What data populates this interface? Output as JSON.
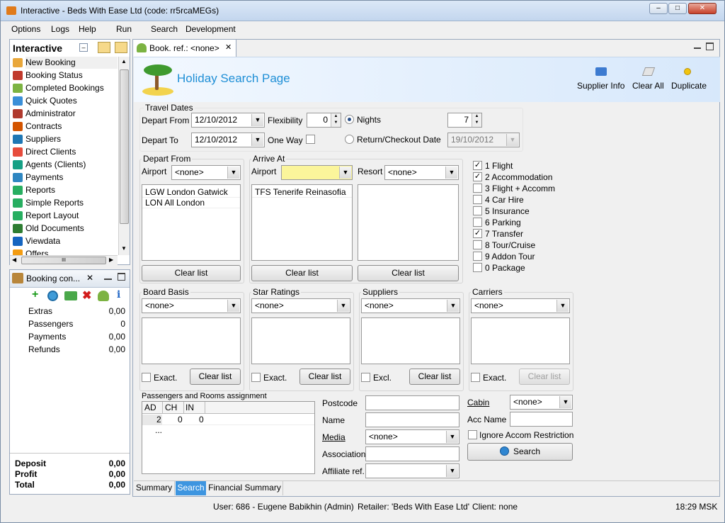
{
  "window": {
    "title": "Interactive - Beds With Ease Ltd (code: rr5rcaMEGs)"
  },
  "menu": [
    "Options",
    "Logs",
    "Help",
    "Run",
    "Search",
    "Development"
  ],
  "nav": {
    "title": "Interactive",
    "items": [
      "New Booking",
      "Booking Status",
      "Completed Bookings",
      "Quick Quotes",
      "Administrator",
      "Contracts",
      "Suppliers",
      "Direct Clients",
      "Agents (Clients)",
      "Payments",
      "Reports",
      "Simple Reports",
      "Report Layout",
      "Old Documents",
      "Viewdata",
      "Offers"
    ],
    "scroll_marker": "III"
  },
  "booking_panel": {
    "title": "Booking con...",
    "rows": [
      {
        "label": "Extras",
        "value": "0,00"
      },
      {
        "label": "Passengers",
        "value": "0"
      },
      {
        "label": "Payments",
        "value": "0,00"
      },
      {
        "label": "Refunds",
        "value": "0,00"
      }
    ],
    "totals": [
      {
        "label": "Deposit",
        "value": "0,00"
      },
      {
        "label": "Profit",
        "value": "0,00"
      },
      {
        "label": "Total",
        "value": "0,00"
      }
    ]
  },
  "tab": {
    "label": "Book. ref.: <none>"
  },
  "page": {
    "title": "Holiday Search Page",
    "actions": [
      "Supplier Info",
      "Clear All",
      "Duplicate"
    ]
  },
  "travel": {
    "group": "Travel Dates",
    "depart_from_label": "Depart From",
    "depart_from": "12/10/2012",
    "depart_to_label": "Depart To",
    "depart_to": "12/10/2012",
    "flexibility_label": "Flexibility",
    "flexibility": "0",
    "one_way_label": "One Way",
    "nights_label": "Nights",
    "nights": "7",
    "return_label": "Return/Checkout Date",
    "return_date": "19/10/2012"
  },
  "depart": {
    "group": "Depart From",
    "airport_label": "Airport",
    "airport": "<none>",
    "items": [
      "LGW London Gatwick",
      "LON All London"
    ],
    "clear": "Clear list"
  },
  "arrive": {
    "group": "Arrive At",
    "airport_label": "Airport",
    "airport": "",
    "resort_label": "Resort",
    "resort": "<none>",
    "items": [
      "TFS Tenerife Reinasofia"
    ],
    "clear": "Clear list",
    "clear2": "Clear list"
  },
  "products": [
    {
      "label": "1 Flight",
      "checked": true
    },
    {
      "label": "2 Accommodation",
      "checked": true
    },
    {
      "label": "3 Flight + Accomm",
      "checked": false
    },
    {
      "label": "4 Car Hire",
      "checked": false
    },
    {
      "label": "5 Insurance",
      "checked": false
    },
    {
      "label": "6 Parking",
      "checked": false
    },
    {
      "label": "7 Transfer",
      "checked": true
    },
    {
      "label": "8 Tour/Cruise",
      "checked": false
    },
    {
      "label": "9 Addon Tour",
      "checked": false
    },
    {
      "label": "0 Package",
      "checked": false
    }
  ],
  "filters": [
    {
      "group": "Board Basis",
      "value": "<none>",
      "check": "Exact.",
      "clear": "Clear list"
    },
    {
      "group": "Star Ratings",
      "value": "<none>",
      "check": "Exact.",
      "clear": "Clear list"
    },
    {
      "group": "Suppliers",
      "value": "<none>",
      "check": "Excl.",
      "clear": "Clear list"
    },
    {
      "group": "Carriers",
      "value": "<none>",
      "check": "Exact.",
      "clear": "Clear list"
    }
  ],
  "pax": {
    "group": "Passengers and Rooms assignment",
    "cols": [
      "AD",
      "CH",
      "IN"
    ],
    "row": [
      "2",
      "0",
      "0"
    ],
    "more": "..."
  },
  "form": {
    "postcode": "Postcode",
    "name": "Name",
    "media": "Media",
    "media_value": "<none>",
    "association": "Association",
    "affiliate": "Affiliate ref.",
    "cabin": "Cabin",
    "cabin_value": "<none>",
    "acc_name": "Acc Name",
    "ignore": "Ignore Accom Restriction",
    "search": "Search"
  },
  "bottom_tabs": [
    "Summary",
    "Search",
    "Financial Summary"
  ],
  "status": {
    "user": "User: 686 - Eugene Babikhin (Admin)",
    "retailer": "Retailer: 'Beds With Ease Ltd'",
    "client": "Client: none",
    "time": "18:29 MSK"
  }
}
